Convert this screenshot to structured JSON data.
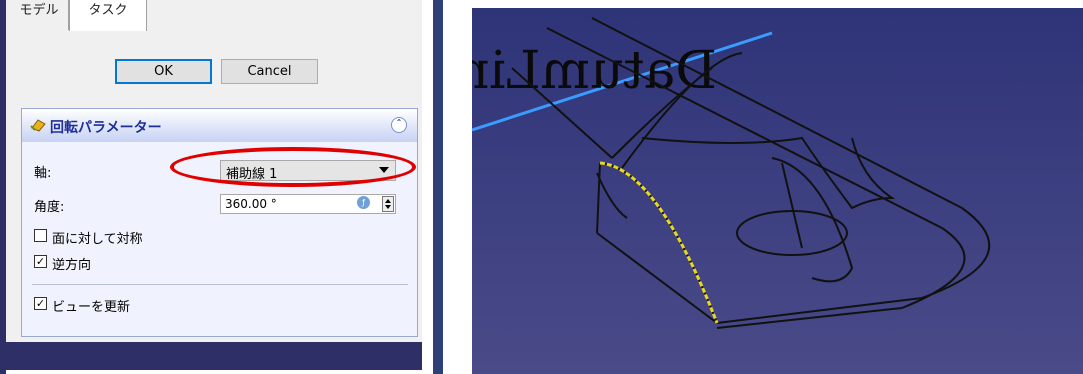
{
  "tabs": [
    {
      "label": "モデル",
      "selected": false
    },
    {
      "label": "タスク",
      "selected": true
    }
  ],
  "buttons": {
    "ok": "OK",
    "cancel": "Cancel"
  },
  "section": {
    "title": "回転パラメーター",
    "icon": "revolve-icon",
    "collapse_icon": "collapse-up-icon"
  },
  "fields": {
    "axis_label": "軸:",
    "axis_value": "補助線 1",
    "angle_label": "角度:",
    "angle_value": "360.00 °"
  },
  "checkboxes": [
    {
      "label": "面に対して対称",
      "checked": false
    },
    {
      "label": "逆方向",
      "checked": true
    },
    {
      "label": "ビューを更新",
      "checked": true
    }
  ],
  "viewport": {
    "text": "DatumLine",
    "background": "#3f3f84",
    "highlight_color": "#e6d81e",
    "axis_line_color": "#3a9cff"
  },
  "colors": {
    "accent": "#0078d7",
    "annotation_red": "#e00000"
  }
}
